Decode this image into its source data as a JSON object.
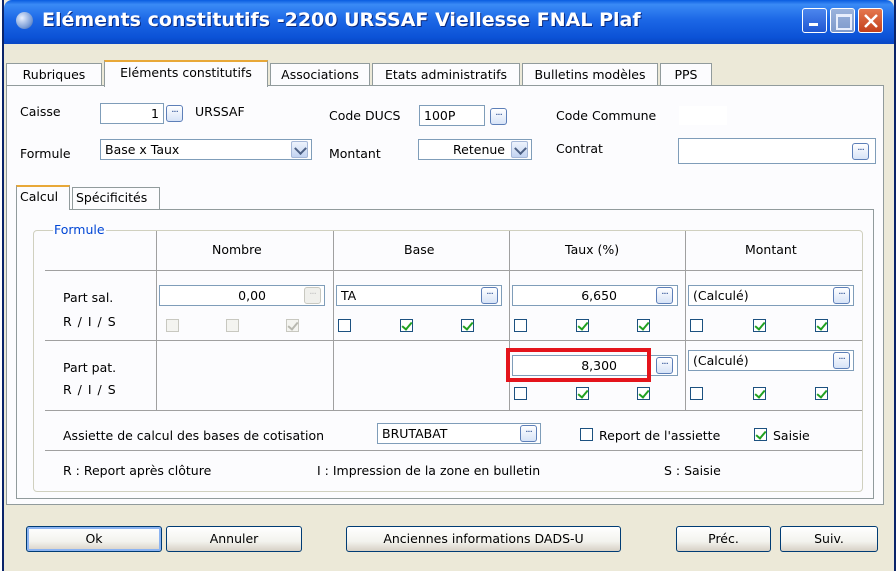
{
  "window": {
    "title": "Eléments constitutifs -2200 URSSAF Viellesse FNAL Plaf",
    "icon": "app-globe-icon",
    "controls": [
      "minimize-icon",
      "maximize-icon",
      "close-icon"
    ]
  },
  "tabs": [
    {
      "label": "Rubriques"
    },
    {
      "label": "Eléments constitutifs",
      "active": true
    },
    {
      "label": "Associations"
    },
    {
      "label": "Etats administratifs"
    },
    {
      "label": "Bulletins modèles"
    },
    {
      "label": "PPS"
    }
  ],
  "header": {
    "caisse_label": "Caisse",
    "caisse_value": "1",
    "caisse_name": "URSSAF",
    "code_ducs_label": "Code DUCS",
    "code_ducs_value": "100P",
    "code_commune_label": "Code Commune",
    "code_commune_value": "",
    "formule_label": "Formule",
    "formule_value": "Base x Taux",
    "montant_label": "Montant",
    "montant_value": "Retenue",
    "contrat_label": "Contrat",
    "contrat_value": ""
  },
  "subtabs": [
    {
      "label": "Calcul",
      "active": true
    },
    {
      "label": "Spécificités"
    }
  ],
  "formule_group": {
    "legend": "Formule",
    "columns": [
      "Nombre",
      "Base",
      "Taux (%)",
      "Montant"
    ],
    "rows": [
      {
        "label": "Part sal.",
        "ris_label": "R / I / S",
        "nombre": "0,00",
        "base": "TA",
        "taux": "6,650",
        "montant": "(Calculé)",
        "nombre_ris": [
          false,
          false,
          true
        ],
        "base_ris": [
          false,
          true,
          true
        ],
        "taux_ris": [
          false,
          true,
          true
        ],
        "montant_ris": [
          false,
          true,
          true
        ]
      },
      {
        "label": "Part pat.",
        "ris_label": "R / I / S",
        "taux": "8,300",
        "montant": "(Calculé)",
        "taux_ris": [
          false,
          true,
          true
        ],
        "montant_ris": [
          false,
          true,
          true
        ]
      }
    ],
    "assiette_label": "Assiette de calcul des bases de cotisation",
    "assiette_value": "BRUTABAT",
    "report_assiette_label": "Report de l'assiette",
    "report_assiette_checked": false,
    "saisie_label": "Saisie",
    "saisie_checked": true,
    "legend_r": "R : Report après clôture",
    "legend_i": "I : Impression de la zone en bulletin",
    "legend_s": "S : Saisie"
  },
  "buttons": {
    "ok": "Ok",
    "annuler": "Annuler",
    "anciennes": "Anciennes informations DADS-U",
    "prec": "Préc.",
    "suiv": "Suiv."
  },
  "colors": {
    "titlebar": "#0b52d6",
    "highlight": "#e4141c",
    "legend": "#0046d5",
    "check": "#21a121"
  }
}
